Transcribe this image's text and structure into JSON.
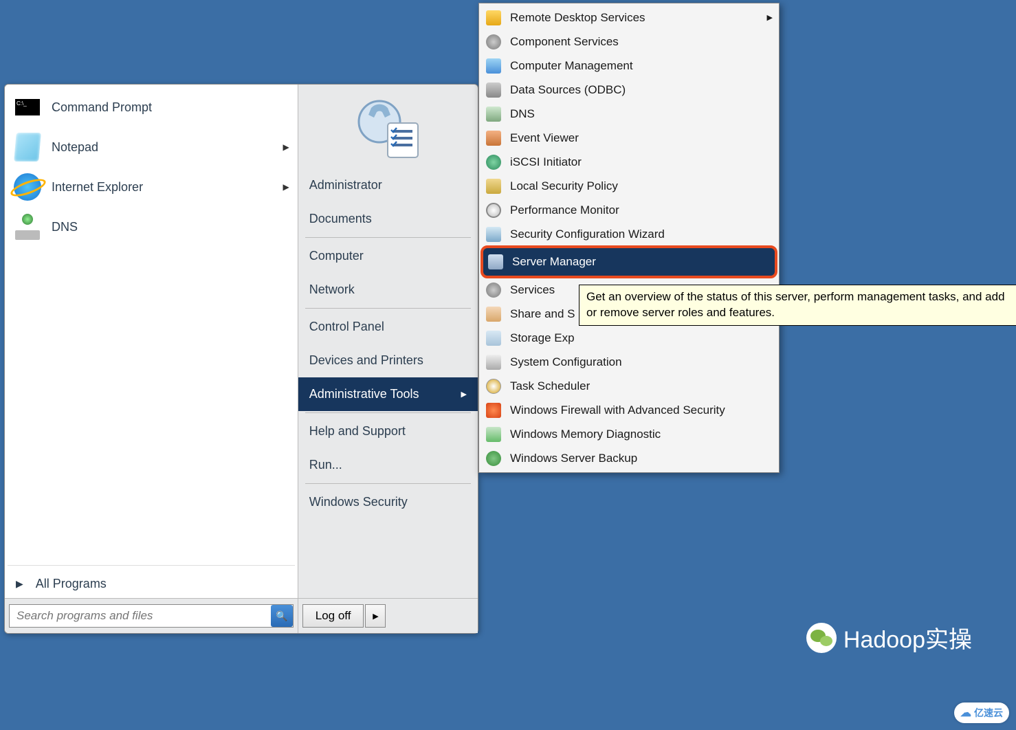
{
  "start_menu": {
    "pinned": [
      {
        "label": "Command Prompt",
        "icon": "cmd-icon",
        "has_submenu": false
      },
      {
        "label": "Notepad",
        "icon": "notepad-icon",
        "has_submenu": true
      },
      {
        "label": "Internet Explorer",
        "icon": "ie-icon",
        "has_submenu": true
      },
      {
        "label": "DNS",
        "icon": "dns-icon",
        "has_submenu": false
      }
    ],
    "all_programs": "All Programs",
    "search_placeholder": "Search programs and files",
    "right": [
      {
        "label": "Administrator",
        "divider_after": false
      },
      {
        "label": "Documents",
        "divider_after": true
      },
      {
        "label": "Computer",
        "divider_after": false
      },
      {
        "label": "Network",
        "divider_after": true
      },
      {
        "label": "Control Panel",
        "divider_after": false
      },
      {
        "label": "Devices and Printers",
        "divider_after": false
      },
      {
        "label": "Administrative Tools",
        "divider_after": true,
        "selected": true,
        "has_submenu": true
      },
      {
        "label": "Help and Support",
        "divider_after": false
      },
      {
        "label": "Run...",
        "divider_after": true
      },
      {
        "label": "Windows Security",
        "divider_after": false
      }
    ],
    "logoff_label": "Log off"
  },
  "submenu": {
    "items": [
      {
        "label": "Remote Desktop Services",
        "icon": "ico-folder",
        "has_submenu": true
      },
      {
        "label": "Component Services",
        "icon": "ico-gear"
      },
      {
        "label": "Computer Management",
        "icon": "ico-comp"
      },
      {
        "label": "Data Sources (ODBC)",
        "icon": "ico-db"
      },
      {
        "label": "DNS",
        "icon": "ico-dns"
      },
      {
        "label": "Event Viewer",
        "icon": "ico-event"
      },
      {
        "label": "iSCSI Initiator",
        "icon": "ico-globe"
      },
      {
        "label": "Local Security Policy",
        "icon": "ico-lock"
      },
      {
        "label": "Performance Monitor",
        "icon": "ico-perf"
      },
      {
        "label": "Security Configuration Wizard",
        "icon": "ico-sec"
      },
      {
        "label": "Server Manager",
        "icon": "ico-server",
        "selected": true,
        "highlighted": true
      },
      {
        "label": "Services",
        "icon": "ico-gear"
      },
      {
        "label": "Share and Storage Management",
        "icon": "ico-share",
        "truncated": "Share and S"
      },
      {
        "label": "Storage Explorer",
        "icon": "ico-storage",
        "truncated": "Storage Exp"
      },
      {
        "label": "System Configuration",
        "icon": "ico-sysconf"
      },
      {
        "label": "Task Scheduler",
        "icon": "ico-clock"
      },
      {
        "label": "Windows Firewall with Advanced Security",
        "icon": "ico-firewall"
      },
      {
        "label": "Windows Memory Diagnostic",
        "icon": "ico-mem"
      },
      {
        "label": "Windows Server Backup",
        "icon": "ico-backup"
      }
    ]
  },
  "tooltip": "Get an overview of the status of this server, perform management tasks, and add or remove server roles and features.",
  "watermark": "Hadoop实操",
  "brand": "亿速云"
}
